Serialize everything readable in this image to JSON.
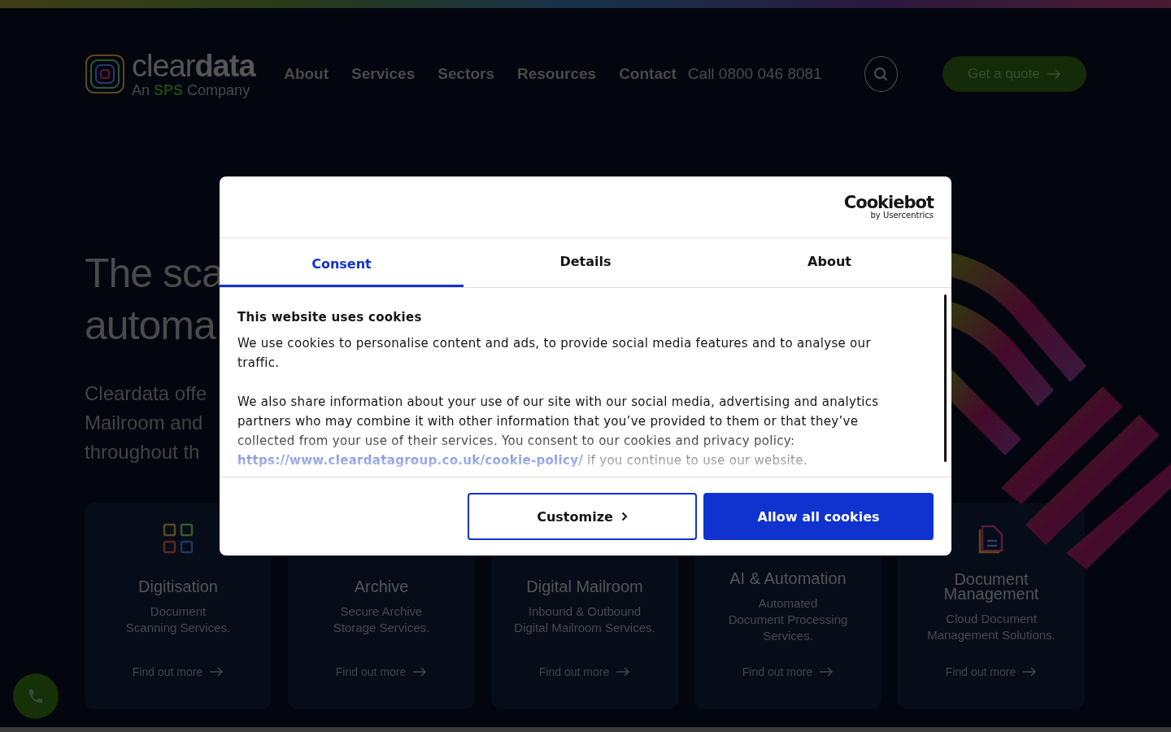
{
  "header": {
    "logo": {
      "word_light": "clear",
      "word_bold": "data",
      "tagline_start": "An",
      "tagline_brand": "SPS",
      "tagline_end": "Company"
    },
    "nav": [
      {
        "label": "About"
      },
      {
        "label": "Services"
      },
      {
        "label": "Sectors"
      },
      {
        "label": "Resources"
      },
      {
        "label": "Contact"
      }
    ],
    "phone": "Call 0800 046 8081",
    "cta": "Get a quote"
  },
  "hero": {
    "title_lines": [
      "The sca",
      "automa"
    ],
    "intro_lines": [
      "Cleardata offe",
      "Mailroom and",
      "throughout th"
    ]
  },
  "cards": [
    {
      "title_lines": [
        "Digitisation"
      ],
      "text_lines": [
        "Document",
        "Scanning Services."
      ],
      "link": "Find out more",
      "kind": "qr"
    },
    {
      "title_lines": [
        "Archive"
      ],
      "text_lines": [
        "Secure Archive",
        "Storage Services."
      ],
      "link": "Find out more",
      "kind": "plain"
    },
    {
      "title_lines": [
        "Digital Mailroom"
      ],
      "text_lines": [
        "Inbound & Outbound",
        "Digital Mailroom Services."
      ],
      "link": "Find out more",
      "kind": "plain"
    },
    {
      "title_lines": [
        "AI & Automation"
      ],
      "text_lines": [
        "Automated",
        "Document Processing",
        "Services."
      ],
      "link": "Find out more",
      "kind": "plain"
    },
    {
      "title_lines": [
        "Document",
        "Management"
      ],
      "text_lines": [
        "Cloud Document",
        "Management Solutions."
      ],
      "link": "Find out more",
      "kind": "document"
    }
  ],
  "cookie_dialog": {
    "brand": "Cookiebot",
    "brand_sub": "by Usercentrics",
    "tabs": [
      {
        "label": "Consent",
        "selected": true
      },
      {
        "label": "Details",
        "selected": false
      },
      {
        "label": "About",
        "selected": false
      }
    ],
    "heading": "This website uses cookies",
    "paragraphs": [
      {
        "text": "We use cookies to personalise content and ads, to provide social media features and to analyse our traffic."
      },
      {
        "text": "We also share information about your use of our site with our social media, advertising and analytics partners who may combine it with other information that you’ve provided to them or that they’ve collected from your use of their services. You consent to our cookies and privacy policy:",
        "link": "https://www.cleardatagroup.co.uk/cookie-policy/",
        "after": "if you continue to use our website."
      }
    ],
    "customize": "Customize",
    "allow": "Allow all cookies"
  }
}
